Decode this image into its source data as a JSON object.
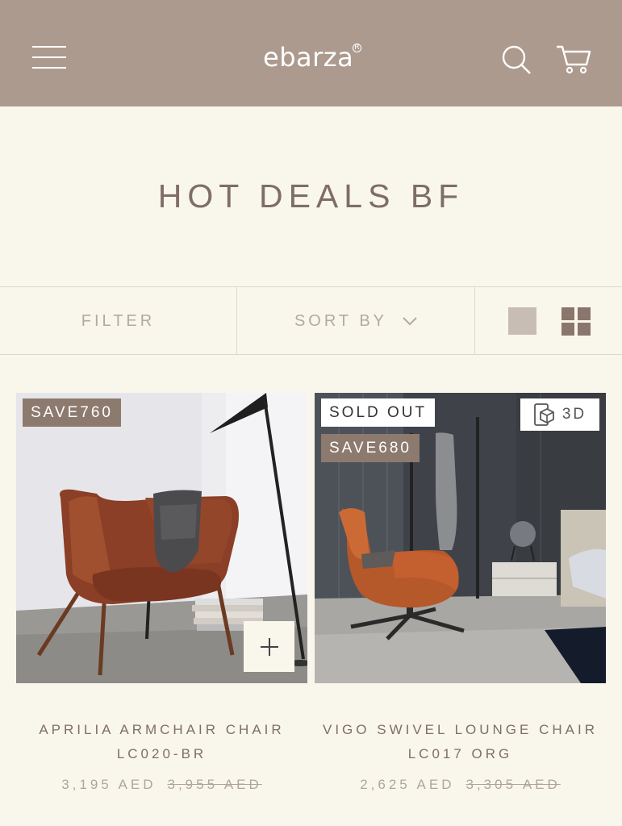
{
  "header": {
    "logo": "ebarza",
    "logo_mark": "R",
    "icons": [
      "menu-icon",
      "search-icon",
      "cart-icon"
    ],
    "background_color": "#ad9a8f"
  },
  "page": {
    "title": "HOT DEALS BF"
  },
  "toolbar": {
    "filter_label": "FILTER",
    "sort_label": "SORT BY",
    "view_modes": [
      "single-column",
      "grid"
    ]
  },
  "products": [
    {
      "badges": [
        "SAVE760"
      ],
      "name_line1": "APRILIA ARMCHAIR CHAIR",
      "name_line2": "LC020-BR",
      "price": "3,195 AED",
      "old_price": "3,955 AED",
      "quick_add": "+"
    },
    {
      "badges": [
        "SOLD OUT",
        "SAVE680"
      ],
      "view_3d_label": "3D",
      "name_line1": "VIGO SWIVEL LOUNGE CHAIR",
      "name_line2": "LC017 ORG",
      "price": "2,625 AED",
      "old_price": "3,305 AED"
    }
  ]
}
